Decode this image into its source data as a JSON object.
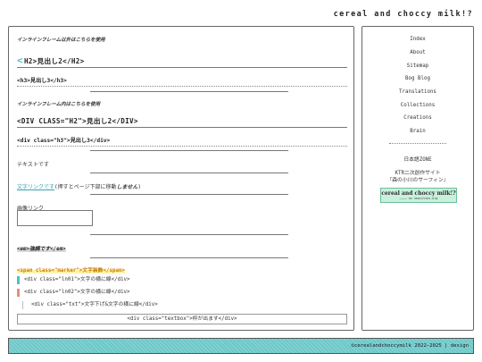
{
  "header": {
    "site_title": "cereal and choccy milk!?"
  },
  "main": {
    "note1": "インラインフレーム以外はこちらを使用",
    "h2_mark": "<",
    "h2a": "H2>見出し2</H2>",
    "h3a": "<h3>見出し3</h3>",
    "note2": "インラインフレーム内はこちらを使用",
    "h2b": "<DIV CLASS=\"H2\">見出し2</DIV>",
    "h3b": "<div class=\"h3\">見出し3</div>",
    "text_label": "テキストです",
    "link_text": "文字リンクです",
    "link_after": "(押すとページ下部に移動",
    "link_strong": "しません",
    "link_close": ")",
    "image_link_label": "画像リンク",
    "em_text": "<em>強調です</em>",
    "marker_text": "<span class=\"marker\">文字装飾</span>",
    "ln01": "<div class=\"ln01\">文字の横に線</div>",
    "ln02": "<div class=\"ln02\">文字の横に線</div>",
    "txt": "<div class=\"txt\">文字下げ&文字の横に線</div>",
    "textbox": "<div class=\"textbox\">枠が出ます</div>"
  },
  "sidebar": {
    "nav": [
      "Index",
      "About",
      "Sitemap",
      "Bog Blog",
      "Translations",
      "Collections",
      "Creations",
      "Brain"
    ],
    "zone": "日本語ZONE",
    "ktr_line1": "KTR二次創作サイト",
    "ktr_line2": "『森の小川のサーフィン』",
    "banner_title": "cereal and choccy milk!?",
    "banner_sub": "———— on neocities.org"
  },
  "footer": {
    "copyright": "©cerealandchoccymilk 2022–2025 | design"
  },
  "colors": {
    "accent_teal": "#4fc1c4",
    "accent_salmon": "#e58e7a",
    "footer_bg": "#6cc8c9",
    "marker_yellow": "#fff3a8"
  }
}
